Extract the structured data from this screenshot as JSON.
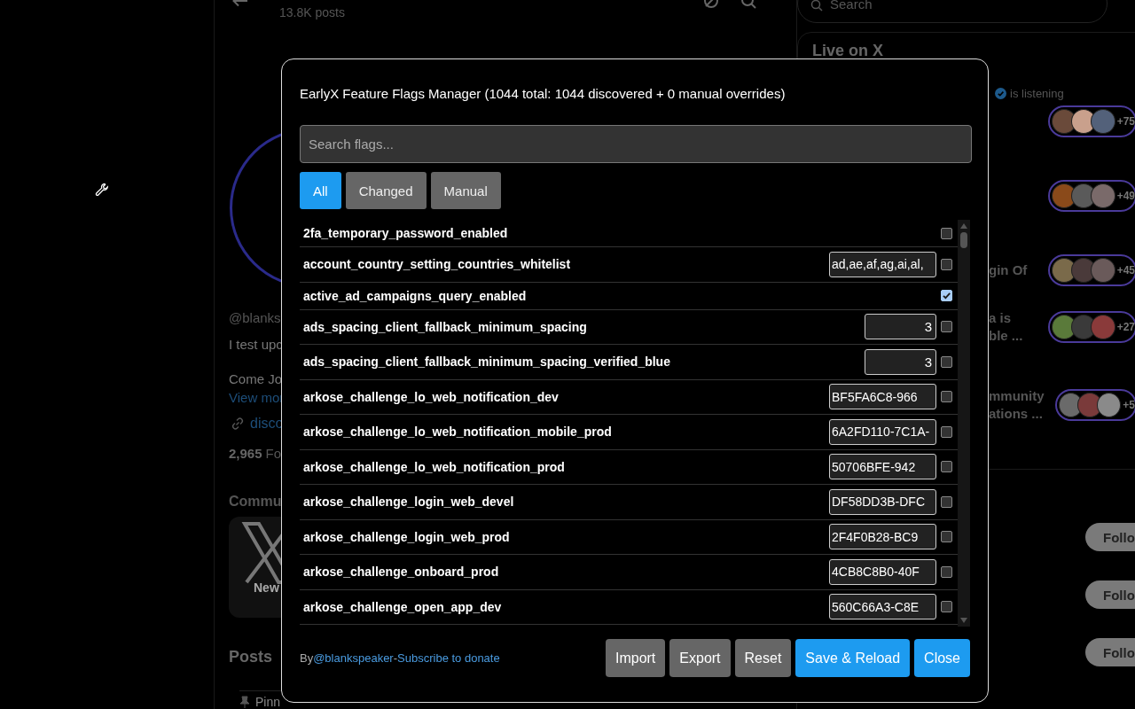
{
  "background": {
    "header": {
      "post_count": "13.8K posts"
    },
    "profile": {
      "handle": "@blanks",
      "bio_line": "I test upc",
      "bio_line_2": "Come Jo",
      "view_more": "View mor",
      "link": "disco",
      "followers_count": "2,965",
      "followers_label": "Fo"
    },
    "communities": {
      "heading": "Commu",
      "card_label": "New"
    },
    "posts_tab": "Posts",
    "pinned": "Pinn",
    "search": {
      "placeholder": "Search"
    },
    "live": {
      "heading": "Live on X",
      "listening": "is listening",
      "spaces": [
        {
          "count": "+75"
        },
        {
          "count": "+49"
        },
        {
          "title_lines": [
            "gin Of"
          ],
          "count": "+45"
        },
        {
          "title_lines": [
            "a is",
            "ble ..."
          ],
          "count": "+27"
        },
        {
          "title_lines": [
            "mmunity",
            "ations ..."
          ],
          "count": "+5"
        }
      ]
    },
    "follow_buttons": [
      "Follo",
      "Follo",
      "Follo"
    ]
  },
  "flags_manager": {
    "title": "EarlyX Feature Flags Manager (1044 total: 1044 discovered + 0 manual overrides)",
    "search": {
      "placeholder": "Search flags..."
    },
    "filters": [
      {
        "label": "All",
        "selected": true
      },
      {
        "label": "Changed",
        "selected": false
      },
      {
        "label": "Manual",
        "selected": false
      }
    ],
    "flags": [
      {
        "name": "2fa_temporary_password_enabled",
        "kind": "toggle",
        "checked": false
      },
      {
        "name": "account_country_setting_countries_whitelist",
        "kind": "text",
        "value": "ad,ae,af,ag,ai,al,",
        "checked": false
      },
      {
        "name": "active_ad_campaigns_query_enabled",
        "kind": "toggle",
        "checked": true
      },
      {
        "name": "ads_spacing_client_fallback_minimum_spacing",
        "kind": "number",
        "value": "3",
        "checked": false
      },
      {
        "name": "ads_spacing_client_fallback_minimum_spacing_verified_blue",
        "kind": "number",
        "value": "3",
        "checked": false
      },
      {
        "name": "arkose_challenge_lo_web_notification_dev",
        "kind": "text",
        "value": "BF5FA6C8-966",
        "checked": false
      },
      {
        "name": "arkose_challenge_lo_web_notification_mobile_prod",
        "kind": "text",
        "value": "6A2FD110-7C1A-",
        "checked": false
      },
      {
        "name": "arkose_challenge_lo_web_notification_prod",
        "kind": "text",
        "value": "50706BFE-942",
        "checked": false
      },
      {
        "name": "arkose_challenge_login_web_devel",
        "kind": "text",
        "value": "DF58DD3B-DFC",
        "checked": false
      },
      {
        "name": "arkose_challenge_login_web_prod",
        "kind": "text",
        "value": "2F4F0B28-BC9",
        "checked": false
      },
      {
        "name": "arkose_challenge_onboard_prod",
        "kind": "text",
        "value": "4CB8C8B0-40F",
        "checked": false
      },
      {
        "name": "arkose_challenge_open_app_dev",
        "kind": "text",
        "value": "560C66A3-C8E",
        "checked": false
      }
    ],
    "credit": [
      {
        "text": "By",
        "kind": "plain"
      },
      {
        "text": "@blankspeaker",
        "kind": "link"
      },
      {
        "text": "-",
        "kind": "plain"
      },
      {
        "text": "Subscribe to donate",
        "kind": "link"
      }
    ],
    "buttons": [
      {
        "label": "Import",
        "kind": "secondary"
      },
      {
        "label": "Export",
        "kind": "secondary"
      },
      {
        "label": "Reset",
        "kind": "secondary"
      },
      {
        "label": "Save & Reload",
        "kind": "primary"
      },
      {
        "label": "Close",
        "kind": "primary"
      }
    ]
  }
}
